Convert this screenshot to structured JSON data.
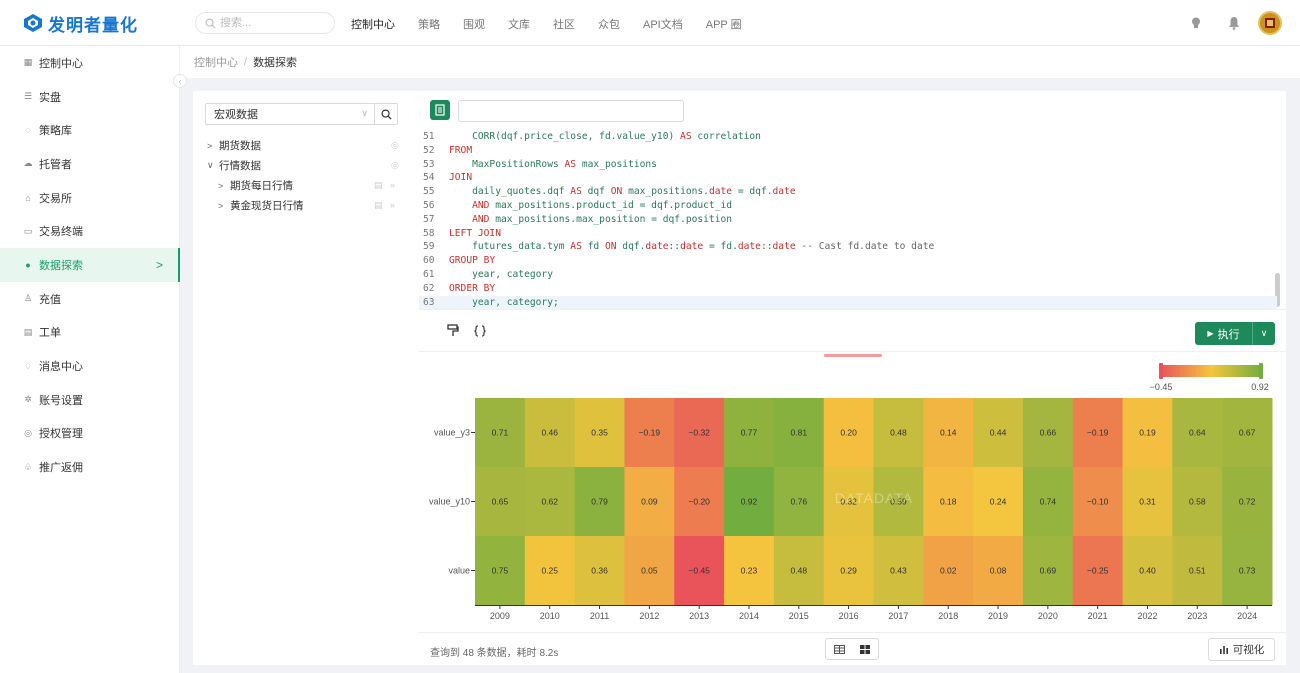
{
  "app": {
    "logo_text": "发明者量化",
    "brand_color": "#1677d2",
    "accent_color": "#1e8a5c"
  },
  "search": {
    "placeholder": "搜索..."
  },
  "nav": [
    {
      "label": "控制中心",
      "active": true
    },
    {
      "label": "策略"
    },
    {
      "label": "围观"
    },
    {
      "label": "文库"
    },
    {
      "label": "社区"
    },
    {
      "label": "众包"
    },
    {
      "label": "API文档"
    },
    {
      "label": "APP 圈"
    }
  ],
  "top_icons": [
    "lightbulb-icon",
    "bell-icon",
    "avatar"
  ],
  "sidebar": {
    "items": [
      {
        "label": "控制中心",
        "icon": "dashboard-icon"
      },
      {
        "label": "实盘",
        "icon": "list-icon"
      },
      {
        "label": "策略库",
        "icon": "strategy-icon"
      },
      {
        "label": "托管者",
        "icon": "cloud-icon"
      },
      {
        "label": "交易所",
        "icon": "bank-icon"
      },
      {
        "label": "交易终端",
        "icon": "terminal-icon"
      },
      {
        "label": "数据探索",
        "icon": "data-icon",
        "active": true
      },
      {
        "label": "充值",
        "icon": "user-add-icon"
      },
      {
        "label": "工单",
        "icon": "ticket-icon"
      },
      {
        "label": "消息中心",
        "icon": "bell-icon"
      },
      {
        "label": "账号设置",
        "icon": "gear-icon"
      },
      {
        "label": "授权管理",
        "icon": "key-icon"
      },
      {
        "label": "推广返佣",
        "icon": "share-icon"
      }
    ]
  },
  "breadcrumb": {
    "root": "控制中心",
    "sep": "/",
    "current": "数据探索"
  },
  "tree": {
    "select_value": "宏观数据",
    "nodes": [
      {
        "label": "期货数据",
        "level": 0,
        "expanded": false
      },
      {
        "label": "行情数据",
        "level": 0,
        "expanded": true
      },
      {
        "label": "期货每日行情",
        "level": 1,
        "expanded": false
      },
      {
        "label": "黄金现货日行情",
        "level": 1,
        "expanded": false
      }
    ]
  },
  "editor": {
    "sql_name_value": "",
    "lines": [
      {
        "n": "51",
        "html": "    CORR(dqf.price_close, fd.value_y10) <span class=\"kw\">AS</span> correlation"
      },
      {
        "n": "52",
        "html": "<span class=\"kw\">FROM</span>"
      },
      {
        "n": "53",
        "html": "    MaxPositionRows <span class=\"kw\">AS</span> max_positions"
      },
      {
        "n": "54",
        "html": "<span class=\"kw\">JOIN</span>"
      },
      {
        "n": "55",
        "html": "    daily_quotes.dqf <span class=\"kw\">AS</span> dqf <span class=\"kw\">ON</span> max_positions.<span class=\"kw\">date</span> = dqf.<span class=\"kw\">date</span>"
      },
      {
        "n": "56",
        "html": "    <span class=\"kw\">AND</span> max_positions.product_id = dqf.product_id"
      },
      {
        "n": "57",
        "html": "    <span class=\"kw\">AND</span> max_positions.max_position = dqf.position"
      },
      {
        "n": "58",
        "html": "<span class=\"kw\">LEFT JOIN</span>"
      },
      {
        "n": "59",
        "html": "    futures_data.tym <span class=\"kw\">AS</span> fd <span class=\"kw\">ON</span> dqf.<span class=\"kw\">date</span>::<span class=\"kw\">date</span> = fd.<span class=\"kw\">date</span>::<span class=\"kw\">date</span> <span class=\"cm\">-- Cast fd.date to date</span>"
      },
      {
        "n": "60",
        "html": "<span class=\"kw\">GROUP BY</span>"
      },
      {
        "n": "61",
        "html": "    year, category"
      },
      {
        "n": "62",
        "html": "<span class=\"kw\">ORDER BY</span>"
      },
      {
        "n": "63",
        "html": "    year, category;",
        "active": true
      }
    ]
  },
  "actions": {
    "run_label": "执行"
  },
  "chart_data": {
    "type": "heatmap",
    "title": "",
    "watermark": "DATADATA",
    "x": [
      "2009",
      "2010",
      "2011",
      "2012",
      "2013",
      "2014",
      "2015",
      "2016",
      "2017",
      "2018",
      "2019",
      "2020",
      "2021",
      "2022",
      "2023",
      "2024"
    ],
    "y": [
      "value_y3",
      "value_y10",
      "value"
    ],
    "values": [
      [
        0.71,
        0.46,
        0.35,
        -0.19,
        -0.32,
        0.77,
        0.81,
        0.2,
        0.48,
        0.14,
        0.44,
        0.66,
        -0.19,
        0.19,
        0.64,
        0.67
      ],
      [
        0.65,
        0.62,
        0.79,
        0.09,
        -0.2,
        0.92,
        0.76,
        0.32,
        0.59,
        0.18,
        0.24,
        0.74,
        -0.1,
        0.31,
        0.58,
        0.72
      ],
      [
        0.75,
        0.25,
        0.36,
        0.05,
        -0.45,
        0.23,
        0.48,
        0.29,
        0.43,
        0.02,
        0.08,
        0.69,
        -0.25,
        0.4,
        0.51,
        0.73
      ]
    ],
    "labels": [
      [
        "0.71",
        "0.46",
        "0.35",
        "−0.19",
        "−0.32",
        "0.77",
        "0.81",
        "0.20",
        "0.48",
        "0.14",
        "0.44",
        "0.66",
        "−0.19",
        "0.19",
        "0.64",
        "0.67"
      ],
      [
        "0.65",
        "0.62",
        "0.79",
        "0.09",
        "−0.20",
        "0.92",
        "0.76",
        "0.32",
        "0.59",
        "0.18",
        "0.24",
        "0.74",
        "−0.10",
        "0.31",
        "0.58",
        "0.72"
      ],
      [
        "0.75",
        "0.25",
        "0.36",
        "0.05",
        "−0.45",
        "0.23",
        "0.48",
        "0.29",
        "0.43",
        "0.02",
        "0.08",
        "0.69",
        "−0.25",
        "0.40",
        "0.51",
        "0.73"
      ]
    ],
    "vmin": -0.45,
    "vmax": 0.92,
    "vmin_label": "−0.45",
    "vmax_label": "0.92",
    "colors": {
      "low": "#e8545a",
      "mid": "#f5c53e",
      "high": "#72ad3f"
    },
    "legend_position": "top-right"
  },
  "footer": {
    "stats": "查询到 48 条数据，耗时 8.2s",
    "viz_label": "可视化"
  }
}
